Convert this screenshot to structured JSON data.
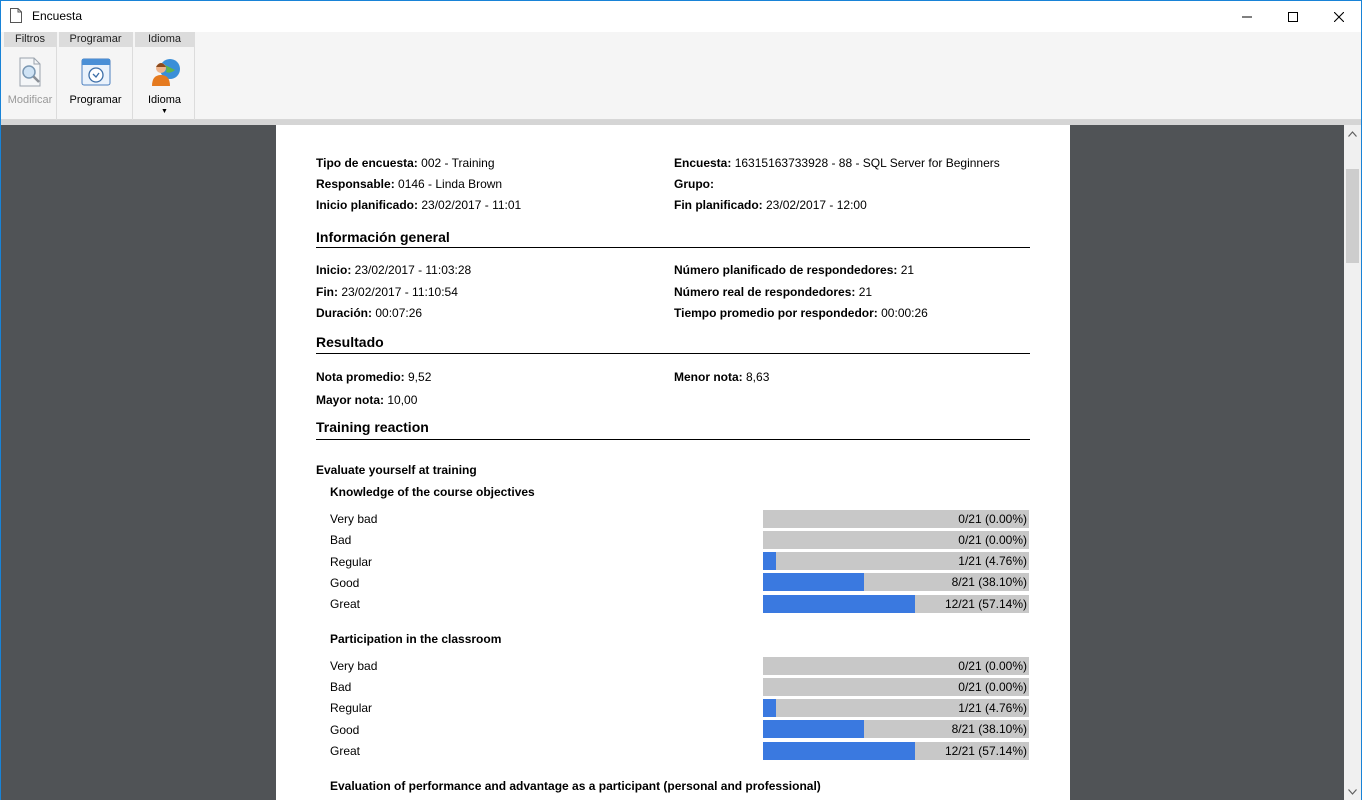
{
  "window": {
    "title": "Encuesta"
  },
  "ribbon": {
    "groups": [
      {
        "header": "Filtros",
        "button": "Modificar"
      },
      {
        "header": "Programar",
        "button": "Programar"
      },
      {
        "header": "Idioma",
        "button": "Idioma"
      }
    ]
  },
  "report": {
    "meta_left": [
      {
        "label": "Tipo de encuesta:",
        "value": " 002 - Training"
      },
      {
        "label": "Responsable:",
        "value": " 0146 - Linda Brown"
      },
      {
        "label": "Inicio planificado:",
        "value": " 23/02/2017 - 11:01"
      }
    ],
    "meta_right": [
      {
        "label": "Encuesta:",
        "value": " 16315163733928 - 88 - SQL Server for Beginners"
      },
      {
        "label": "Grupo:",
        "value": ""
      },
      {
        "label": "Fin planificado:",
        "value": " 23/02/2017 - 12:00"
      }
    ],
    "general": {
      "title": "Información general",
      "left": [
        {
          "label": "Inicio:",
          "value": " 23/02/2017 - 11:03:28"
        },
        {
          "label": "Fin:",
          "value": " 23/02/2017 - 11:10:54"
        },
        {
          "label": "Duración:",
          "value": " 00:07:26"
        }
      ],
      "right": [
        {
          "label": "Número planificado de respondedores:",
          "value": " 21"
        },
        {
          "label": "Número real de respondedores:",
          "value": " 21"
        },
        {
          "label": "Tiempo promedio por respondedor:",
          "value": " 00:00:26"
        }
      ]
    },
    "result": {
      "title": "Resultado",
      "left": [
        {
          "label": "Nota promedio:",
          "value": " 9,52"
        },
        {
          "label": "Mayor nota:",
          "value": " 10,00"
        }
      ],
      "right": [
        {
          "label": "Menor nota:",
          "value": " 8,63"
        }
      ]
    },
    "training": {
      "title": "Training reaction",
      "category": "Evaluate yourself at training",
      "questions": [
        {
          "title": "Knowledge of the course objectives",
          "options": [
            {
              "label": "Very bad",
              "text": "0/21 (0.00%)",
              "fraction": 0.0
            },
            {
              "label": "Bad",
              "text": "0/21 (0.00%)",
              "fraction": 0.0
            },
            {
              "label": "Regular",
              "text": "1/21 (4.76%)",
              "fraction": 0.0476
            },
            {
              "label": "Good",
              "text": "8/21 (38.10%)",
              "fraction": 0.381
            },
            {
              "label": "Great",
              "text": "12/21 (57.14%)",
              "fraction": 0.5714
            }
          ]
        },
        {
          "title": "Participation in the classroom",
          "options": [
            {
              "label": "Very bad",
              "text": "0/21 (0.00%)",
              "fraction": 0.0
            },
            {
              "label": "Bad",
              "text": "0/21 (0.00%)",
              "fraction": 0.0
            },
            {
              "label": "Regular",
              "text": "1/21 (4.76%)",
              "fraction": 0.0476
            },
            {
              "label": "Good",
              "text": "8/21 (38.10%)",
              "fraction": 0.381
            },
            {
              "label": "Great",
              "text": "12/21 (57.14%)",
              "fraction": 0.5714
            }
          ]
        },
        {
          "title": "Evaluation of performance and advantage as a participant (personal and professional)",
          "options": []
        }
      ]
    }
  },
  "colors": {
    "bar_fill": "#3a79e0",
    "bar_track": "#c8c8c8",
    "viewer_bg": "#505356"
  }
}
